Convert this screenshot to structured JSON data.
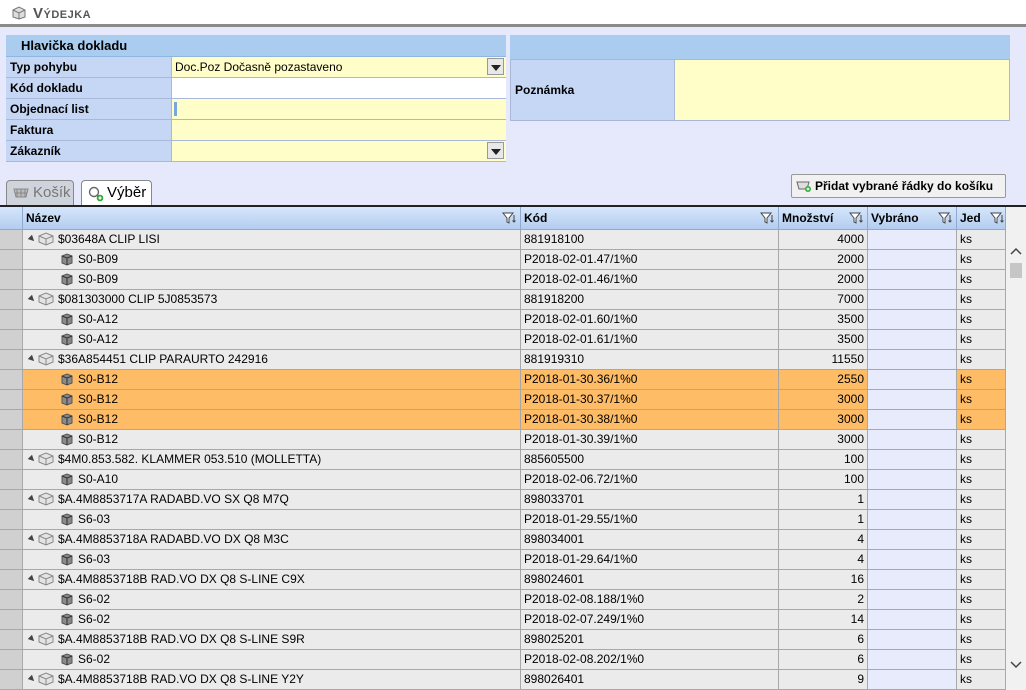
{
  "window": {
    "title": "Výdejka"
  },
  "header_panel": {
    "title": "Hlavička dokladu",
    "fields": {
      "typ_pohybu": {
        "label": "Typ pohybu",
        "value": "Doc.Poz Dočasně pozastaveno"
      },
      "kod_dokladu": {
        "label": "Kód dokladu",
        "value": ""
      },
      "objednaci_list": {
        "label": "Objednací list",
        "value": ""
      },
      "faktura": {
        "label": "Faktura",
        "value": ""
      },
      "zakaznik": {
        "label": "Zákazník",
        "value": ""
      }
    }
  },
  "note_panel": {
    "title": "",
    "label": "Poznámka",
    "value": ""
  },
  "tabs": {
    "kosik": "Košík",
    "vyber": "Výběr"
  },
  "add_button": {
    "label": "Přidat vybrané řádky do košíku"
  },
  "grid": {
    "columns": {
      "nazev": "Název",
      "kod": "Kód",
      "mnozstvi": "Množství",
      "vybrano": "Vybráno",
      "jed": "Jed"
    },
    "rows": [
      {
        "type": "parent",
        "name": "$03648A CLIP LISI",
        "kod": "881918100",
        "mnozstvi": "4000",
        "jed": "ks"
      },
      {
        "type": "child",
        "name": "S0-B09",
        "kod": "P2018-02-01.47/1%0",
        "mnozstvi": "2000",
        "jed": "ks"
      },
      {
        "type": "child",
        "name": "S0-B09",
        "kod": "P2018-02-01.46/1%0",
        "mnozstvi": "2000",
        "jed": "ks"
      },
      {
        "type": "parent",
        "name": "$081303000 CLIP 5J0853573",
        "kod": "881918200",
        "mnozstvi": "7000",
        "jed": "ks"
      },
      {
        "type": "child",
        "name": "S0-A12",
        "kod": "P2018-02-01.60/1%0",
        "mnozstvi": "3500",
        "jed": "ks"
      },
      {
        "type": "child",
        "name": "S0-A12",
        "kod": "P2018-02-01.61/1%0",
        "mnozstvi": "3500",
        "jed": "ks"
      },
      {
        "type": "parent",
        "name": "$36A854451 CLIP PARAURTO 242916",
        "kod": "881919310",
        "mnozstvi": "11550",
        "jed": "ks"
      },
      {
        "type": "child",
        "selected": true,
        "name": "S0-B12",
        "kod": "P2018-01-30.36/1%0",
        "mnozstvi": "2550",
        "jed": "ks"
      },
      {
        "type": "child",
        "selected": true,
        "name": "S0-B12",
        "kod": "P2018-01-30.37/1%0",
        "mnozstvi": "3000",
        "jed": "ks"
      },
      {
        "type": "child",
        "selected": true,
        "name": "S0-B12",
        "kod": "P2018-01-30.38/1%0",
        "mnozstvi": "3000",
        "jed": "ks"
      },
      {
        "type": "child",
        "name": "S0-B12",
        "kod": "P2018-01-30.39/1%0",
        "mnozstvi": "3000",
        "jed": "ks"
      },
      {
        "type": "parent",
        "name": "$4M0.853.582. KLAMMER 053.510 (MOLLETTA)",
        "kod": "885605500",
        "mnozstvi": "100",
        "jed": "ks"
      },
      {
        "type": "child",
        "name": "S0-A10",
        "kod": "P2018-02-06.72/1%0",
        "mnozstvi": "100",
        "jed": "ks"
      },
      {
        "type": "parent",
        "name": "$A.4M8853717A RADABD.VO SX Q8 M7Q",
        "kod": "898033701",
        "mnozstvi": "1",
        "jed": "ks"
      },
      {
        "type": "child",
        "name": "S6-03",
        "kod": "P2018-01-29.55/1%0",
        "mnozstvi": "1",
        "jed": "ks"
      },
      {
        "type": "parent",
        "name": "$A.4M8853718A RADABD.VO DX Q8 M3C",
        "kod": "898034001",
        "mnozstvi": "4",
        "jed": "ks"
      },
      {
        "type": "child",
        "name": "S6-03",
        "kod": "P2018-01-29.64/1%0",
        "mnozstvi": "4",
        "jed": "ks"
      },
      {
        "type": "parent",
        "name": "$A.4M8853718B RAD.VO DX Q8 S-LINE C9X",
        "kod": "898024601",
        "mnozstvi": "16",
        "jed": "ks"
      },
      {
        "type": "child",
        "name": "S6-02",
        "kod": "P2018-02-08.188/1%0",
        "mnozstvi": "2",
        "jed": "ks"
      },
      {
        "type": "child",
        "name": "S6-02",
        "kod": "P2018-02-07.249/1%0",
        "mnozstvi": "14",
        "jed": "ks"
      },
      {
        "type": "parent",
        "name": "$A.4M8853718B RAD.VO DX Q8 S-LINE S9R",
        "kod": "898025201",
        "mnozstvi": "6",
        "jed": "ks"
      },
      {
        "type": "child",
        "name": "S6-02",
        "kod": "P2018-02-08.202/1%0",
        "mnozstvi": "6",
        "jed": "ks"
      },
      {
        "type": "parent",
        "name": "$A.4M8853718B RAD.VO DX Q8 S-LINE Y2Y",
        "kod": "898026401",
        "mnozstvi": "9",
        "jed": "ks"
      }
    ]
  },
  "colors": {
    "selected_row": "#ffbc66",
    "panel_title": "#a9ccef",
    "field_label": "#c6d7f5",
    "field_value": "#fffdc8"
  }
}
